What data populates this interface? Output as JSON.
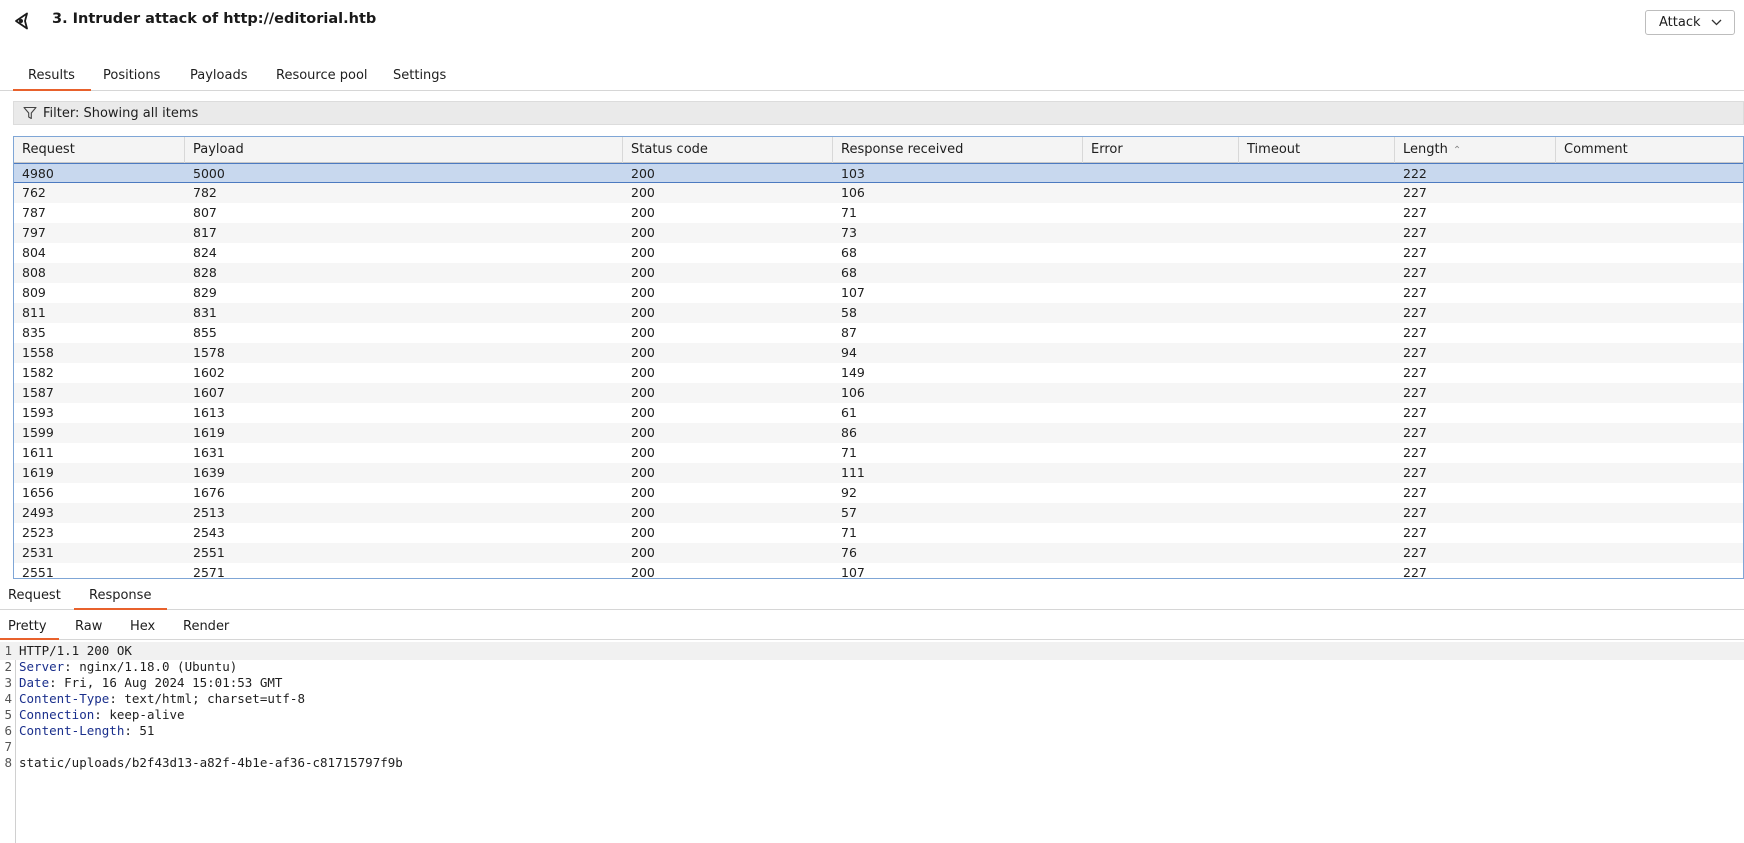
{
  "window": {
    "title": "3. Intruder attack of http://editorial.htb",
    "attack_button": "Attack"
  },
  "tabs": [
    "Results",
    "Positions",
    "Payloads",
    "Resource pool",
    "Settings"
  ],
  "filter": {
    "text": "Filter: Showing all items"
  },
  "table": {
    "columns": [
      "Request",
      "Payload",
      "Status code",
      "Response received",
      "Error",
      "Timeout",
      "Length",
      "Comment"
    ],
    "sort_column": "Length",
    "selected_row": 0,
    "rows": [
      [
        "4980",
        "5000",
        "200",
        "103",
        "",
        "",
        "222",
        ""
      ],
      [
        "762",
        "782",
        "200",
        "106",
        "",
        "",
        "227",
        ""
      ],
      [
        "787",
        "807",
        "200",
        "71",
        "",
        "",
        "227",
        ""
      ],
      [
        "797",
        "817",
        "200",
        "73",
        "",
        "",
        "227",
        ""
      ],
      [
        "804",
        "824",
        "200",
        "68",
        "",
        "",
        "227",
        ""
      ],
      [
        "808",
        "828",
        "200",
        "68",
        "",
        "",
        "227",
        ""
      ],
      [
        "809",
        "829",
        "200",
        "107",
        "",
        "",
        "227",
        ""
      ],
      [
        "811",
        "831",
        "200",
        "58",
        "",
        "",
        "227",
        ""
      ],
      [
        "835",
        "855",
        "200",
        "87",
        "",
        "",
        "227",
        ""
      ],
      [
        "1558",
        "1578",
        "200",
        "94",
        "",
        "",
        "227",
        ""
      ],
      [
        "1582",
        "1602",
        "200",
        "149",
        "",
        "",
        "227",
        ""
      ],
      [
        "1587",
        "1607",
        "200",
        "106",
        "",
        "",
        "227",
        ""
      ],
      [
        "1593",
        "1613",
        "200",
        "61",
        "",
        "",
        "227",
        ""
      ],
      [
        "1599",
        "1619",
        "200",
        "86",
        "",
        "",
        "227",
        ""
      ],
      [
        "1611",
        "1631",
        "200",
        "71",
        "",
        "",
        "227",
        ""
      ],
      [
        "1619",
        "1639",
        "200",
        "111",
        "",
        "",
        "227",
        ""
      ],
      [
        "1656",
        "1676",
        "200",
        "92",
        "",
        "",
        "227",
        ""
      ],
      [
        "2493",
        "2513",
        "200",
        "57",
        "",
        "",
        "227",
        ""
      ],
      [
        "2523",
        "2543",
        "200",
        "71",
        "",
        "",
        "227",
        ""
      ],
      [
        "2531",
        "2551",
        "200",
        "76",
        "",
        "",
        "227",
        ""
      ],
      [
        "2551",
        "2571",
        "200",
        "107",
        "",
        "",
        "227",
        ""
      ]
    ]
  },
  "lower_tabs": [
    "Request",
    "Response"
  ],
  "view_tabs": [
    "Pretty",
    "Raw",
    "Hex",
    "Render"
  ],
  "response": {
    "lines": [
      {
        "num": "1",
        "key": "",
        "value": "HTTP/1.1 200 OK"
      },
      {
        "num": "2",
        "key": "Server",
        "value": ": nginx/1.18.0 (Ubuntu)"
      },
      {
        "num": "3",
        "key": "Date",
        "value": ": Fri, 16 Aug 2024 15:01:53 GMT"
      },
      {
        "num": "4",
        "key": "Content-Type",
        "value": ": text/html; charset=utf-8"
      },
      {
        "num": "5",
        "key": "Connection",
        "value": ": keep-alive"
      },
      {
        "num": "6",
        "key": "Content-Length",
        "value": ": 51"
      },
      {
        "num": "7",
        "key": "",
        "value": ""
      },
      {
        "num": "8",
        "key": "",
        "value": "static/uploads/b2f43d13-a82f-4b1e-af36-c81715797f9b"
      }
    ]
  },
  "colors": {
    "accent": "#e8612c",
    "selection": "#c8d8ee",
    "header_key": "#1a2f8c"
  }
}
